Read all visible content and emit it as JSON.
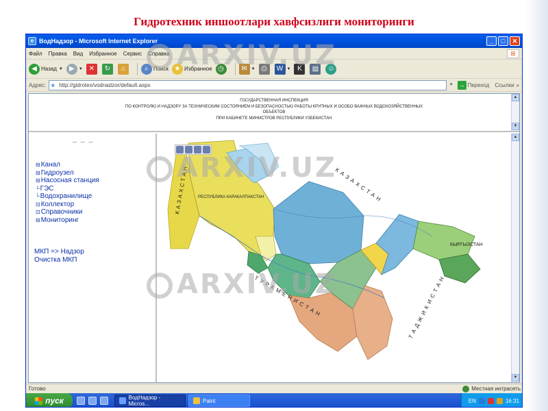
{
  "slide": {
    "title": "Гидротехник иншоотлари хавфсизлиги мониторинги"
  },
  "window": {
    "title": "ВодНадзор - Microsoft Internet Explorer",
    "controls": {
      "minimize": "_",
      "maximize": "□",
      "close": "✕"
    }
  },
  "menubar": {
    "items": [
      "Файл",
      "Правка",
      "Вид",
      "Избранное",
      "Сервис",
      "Справка"
    ]
  },
  "toolbar": {
    "back_label": "Назад",
    "search_label": "Поиск",
    "favorites_label": "Избранное"
  },
  "addressbar": {
    "label": "Адрес:",
    "value": "http://gidrotex/vodnadzor/default.aspx",
    "go_label": "Переход",
    "links_label": "Ссылки"
  },
  "header_frame": {
    "lines": [
      "ГОСУДАРСТВЕННАЯ ИНСПЕКЦИЯ",
      "ПО КОНТРОЛЮ И НАДЗОРУ ЗА ТЕХНИЧЕСКИМ СОСТОЯНИЕМ И БЕЗОПАСНОСТЬЮ РАБОТЫ КРУПНЫХ И ОСОБО ВАЖНЫХ ВОДОХОЗЯЙСТВЕННЫХ",
      "ОБЪЕКТОВ",
      "ПРИ КАБИНЕТЕ МИНИСТРОВ РЕСПУБЛИКИ УЗБЕКИСТАН"
    ]
  },
  "left_menu": {
    "top_text": "— — —",
    "items": [
      {
        "toggle": "⊟",
        "label": "Канал"
      },
      {
        "toggle": "⊟",
        "label": "Гидроузел"
      },
      {
        "toggle": "⊟",
        "label": "Насосная станция"
      },
      {
        "toggle": "└",
        "label": "ГЭС"
      },
      {
        "toggle": "└",
        "label": "Водохранилище"
      },
      {
        "toggle": "⊡",
        "label": "Коллектор"
      },
      {
        "toggle": "⊡",
        "label": "Справочники"
      },
      {
        "toggle": "⊟",
        "label": "Мониторинг"
      }
    ],
    "links": [
      "МКП => Надзор",
      "Очистка МКП"
    ]
  },
  "map": {
    "labels": {
      "kazakhstan_west": "КАЗАХСТАН",
      "kazakhstan_east": "КАЗАХСТАН",
      "karakalpakstan": "РЕСПУБЛИКА КАРАКАЛПАКСТАН",
      "kyrgyzstan": "КЫРГЫЗСТАН",
      "turkmenistan": "ТУРКМЕНИСТАН",
      "tajikistan": "ТАДЖИКИСТАН"
    },
    "colors": {
      "karakalpakstan": "#e9df5c",
      "khorezm": "#f3f0a8",
      "navoi": "#6fb0d6",
      "bukhara": "#4fa86b",
      "kashkadarya": "#e5a77e",
      "surkhandarya": "#e8b088",
      "samarkand": "#8bc28f",
      "jizzakh": "#f2d64a",
      "tashkent": "#7db8de",
      "fergana": "#9bcf7a",
      "lake": "#a8d4ee"
    }
  },
  "statusbar": {
    "text": "Готово",
    "zone": "Местная интрасеть"
  },
  "taskbar": {
    "start_label": "пуск",
    "tasks": [
      "ВодНадзор - Micros...",
      "Paint"
    ],
    "lang": "EN",
    "clock": "16:31"
  },
  "watermark": {
    "text": "ARXIV.UZ"
  }
}
